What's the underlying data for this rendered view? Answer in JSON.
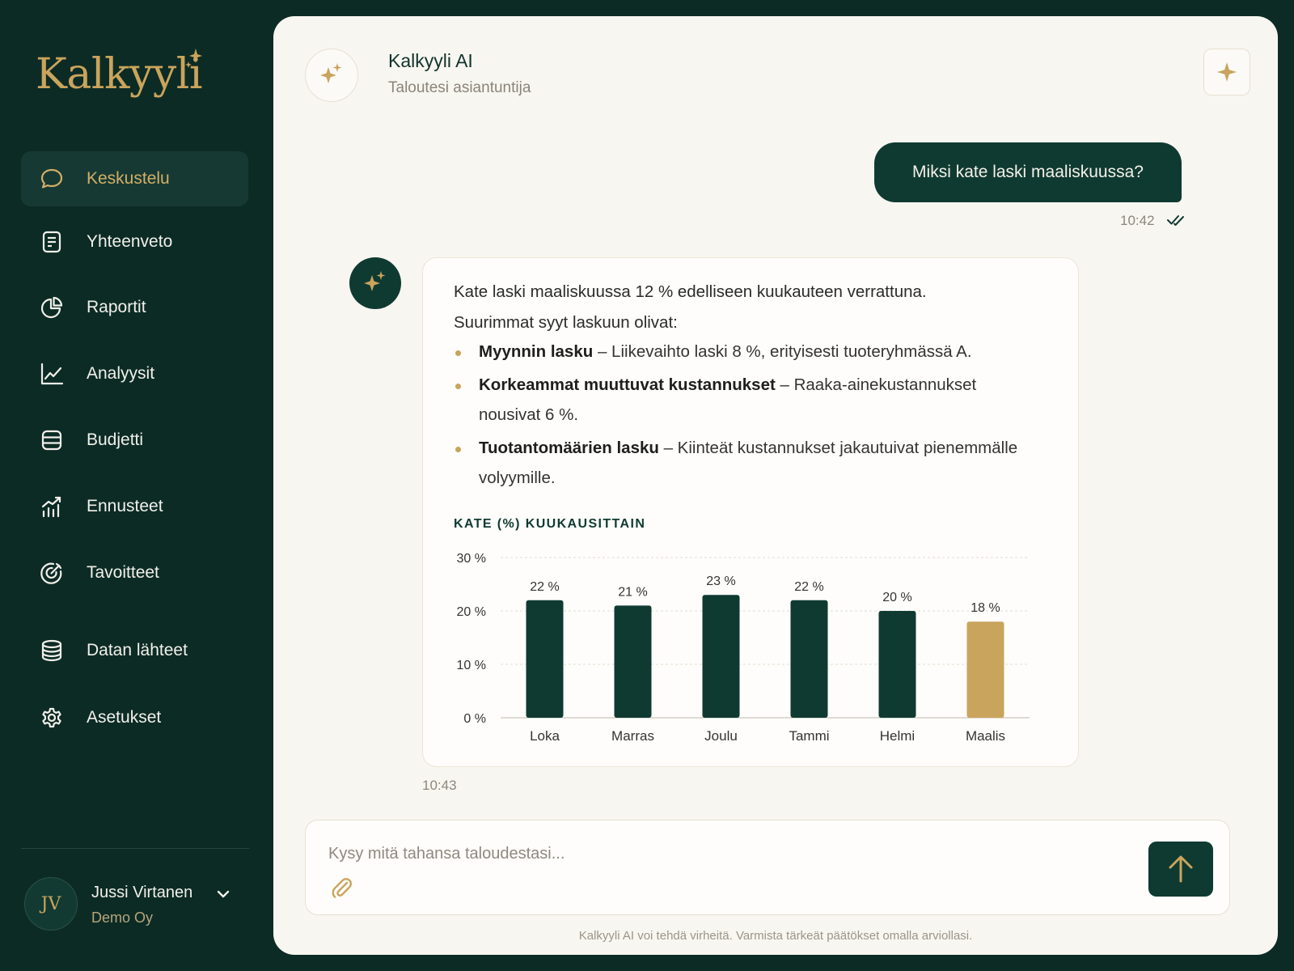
{
  "app": {
    "logo": "Kalkyyli"
  },
  "sidebar": {
    "items": [
      {
        "label": "Keskustelu",
        "icon": "chat-bubble-icon",
        "active": true
      },
      {
        "label": "Yhteenveto",
        "icon": "document-icon"
      },
      {
        "label": "Raportit",
        "icon": "pie-chart-icon"
      },
      {
        "label": "Analyysit",
        "icon": "line-chart-icon"
      },
      {
        "label": "Budjetti",
        "icon": "budget-icon"
      },
      {
        "label": "Ennusteet",
        "icon": "forecast-icon"
      },
      {
        "label": "Tavoitteet",
        "icon": "target-icon"
      },
      {
        "label": "Datan lähteet",
        "icon": "database-icon"
      },
      {
        "label": "Asetukset",
        "icon": "gear-icon"
      }
    ],
    "user": {
      "initials": "JV",
      "name": "Jussi Virtanen",
      "org": "Demo Oy"
    }
  },
  "header": {
    "title": "Kalkyyli AI",
    "subtitle": "Taloutesi asiantuntija"
  },
  "conversation": {
    "user_message": {
      "text": "Miksi kate laski maaliskuussa?",
      "time": "10:42"
    },
    "ai_message": {
      "intro_line1": "Kate laski maaliskuussa 12 % edelliseen kuukauteen verrattuna.",
      "intro_line2": "Suurimmat syyt laskuun olivat:",
      "bullets": [
        {
          "bold": "Myynnin lasku",
          "text": " – Liikevaihto laski 8 %, erityisesti tuoteryhmässä A."
        },
        {
          "bold": "Korkeammat muuttuvat kustannukset",
          "text": " – Raaka-ainekustannukset nousivat 6 %."
        },
        {
          "bold": "Tuotantomäärien lasku",
          "text": " – Kiinteät kustannukset jakautuivat pienemmälle volyymille."
        }
      ],
      "time": "10:43"
    }
  },
  "chart_data": {
    "type": "bar",
    "title": "KATE (%) KUUKAUSITTAIN",
    "categories": [
      "Loka",
      "Marras",
      "Joulu",
      "Tammi",
      "Helmi",
      "Maalis"
    ],
    "values": [
      22,
      21,
      23,
      22,
      20,
      18
    ],
    "value_labels": [
      "22 %",
      "21 %",
      "23 %",
      "22 %",
      "20 %",
      "18 %"
    ],
    "ylim": [
      0,
      30
    ],
    "yticks": [
      "0 %",
      "10 %",
      "20 %",
      "30 %"
    ],
    "grid": true,
    "colors": {
      "default": "#0f3a31",
      "highlight": "#c9a45c"
    },
    "highlight_index": 5
  },
  "composer": {
    "placeholder": "Kysy mitä tahansa taloudestasi...",
    "value": ""
  },
  "footer": {
    "disclaimer": "Kalkyyli AI voi tehdä virheitä. Varmista tärkeät päätökset omalla arviollasi."
  },
  "colors": {
    "sidebar_bg": "#0c2b25",
    "accent_gold": "#c9a45c",
    "primary_green": "#0f3a31",
    "panel_bg": "#f8f6f1"
  }
}
